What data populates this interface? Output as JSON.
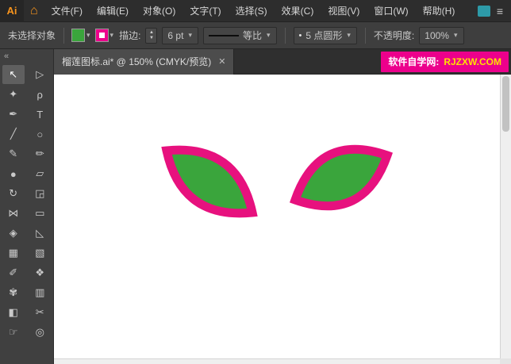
{
  "menubar": {
    "logo": "Ai",
    "home_icon": "⌂",
    "items": [
      {
        "label": "文件(F)"
      },
      {
        "label": "编辑(E)"
      },
      {
        "label": "对象(O)"
      },
      {
        "label": "文字(T)"
      },
      {
        "label": "选择(S)"
      },
      {
        "label": "效果(C)"
      },
      {
        "label": "视图(V)"
      },
      {
        "label": "窗口(W)"
      },
      {
        "label": "帮助(H)"
      }
    ],
    "panel_menu_glyph": "≡"
  },
  "controlbar": {
    "selection_status": "未选择对象",
    "stroke_label": "描边:",
    "stepper_up": "▲",
    "stepper_down": "▼",
    "stroke_width": "6 pt",
    "profile_label": "等比",
    "brush_bullet": "•",
    "brush_label": "5 点圆形",
    "opacity_label": "不透明度:",
    "opacity_value": "100%",
    "chevron": "▾"
  },
  "tabbar": {
    "tab_title": "榴莲图标.ai* @ 150% (CMYK/预览)",
    "close": "✕",
    "banner_prefix": "软件自学网:",
    "banner_site": "RJZXW.COM"
  },
  "toolbar": {
    "collapse": "«",
    "tools": [
      {
        "name": "selection",
        "glyph": "↖"
      },
      {
        "name": "direct-selection",
        "glyph": "▷"
      },
      {
        "name": "magic-wand",
        "glyph": "✦"
      },
      {
        "name": "lasso",
        "glyph": "ρ"
      },
      {
        "name": "pen",
        "glyph": "✒"
      },
      {
        "name": "type",
        "glyph": "T"
      },
      {
        "name": "line-segment",
        "glyph": "╱"
      },
      {
        "name": "ellipse",
        "glyph": "○"
      },
      {
        "name": "paintbrush",
        "glyph": "✎"
      },
      {
        "name": "pencil",
        "glyph": "✏"
      },
      {
        "name": "blob-brush",
        "glyph": "●"
      },
      {
        "name": "eraser",
        "glyph": "▱"
      },
      {
        "name": "rotate",
        "glyph": "↻"
      },
      {
        "name": "scale",
        "glyph": "◲"
      },
      {
        "name": "width",
        "glyph": "⋈"
      },
      {
        "name": "free-transform",
        "glyph": "▭"
      },
      {
        "name": "shape-builder",
        "glyph": "◈"
      },
      {
        "name": "perspective-grid",
        "glyph": "◺"
      },
      {
        "name": "mesh",
        "glyph": "▦"
      },
      {
        "name": "gradient",
        "glyph": "▧"
      },
      {
        "name": "eyedropper",
        "glyph": "✐"
      },
      {
        "name": "blend",
        "glyph": "❖"
      },
      {
        "name": "symbol-sprayer",
        "glyph": "✾"
      },
      {
        "name": "column-graph",
        "glyph": "▥"
      },
      {
        "name": "artboard",
        "glyph": "◧"
      },
      {
        "name": "slice",
        "glyph": "✂"
      },
      {
        "name": "hand",
        "glyph": "☞"
      },
      {
        "name": "zoom",
        "glyph": "◎"
      }
    ]
  },
  "colors": {
    "leaf_fill": "#3aa53c",
    "leaf_stroke": "#e7117e",
    "fill_swatch": "#3aa53c",
    "stroke_swatch": "#ec008c",
    "banner_bg": "#ec008c"
  }
}
